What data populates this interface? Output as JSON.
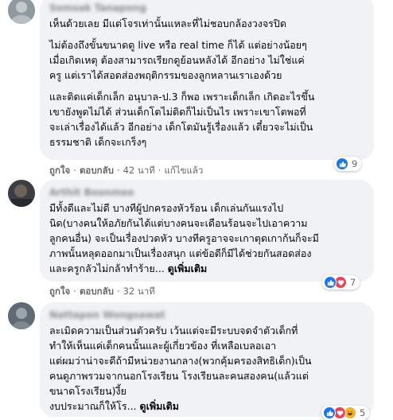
{
  "comments": [
    {
      "paragraphs": [
        "เห็นด้วยเลย มีแต่โจรเท่านั้นแหละที่ไม่ชอบกล้องวงจรปิด",
        "ไม่ต้องถึงขั้นขนาดดู live หรือ real time ก็ได้ แต่อย่างน้อยๆ\nเมื่อเกิดเหตุ ต้องสามารถเรียกดูย้อนหลังได้ อีกอย่าง ไม่ใช่แค่\nครู แต่เราได้สอดส่องพฤติกรรมของลูกหลานเราเองด้วย",
        "และติดแค่เด็กเล็ก อนุบาล-ป.3 ก็พอ เพราะเด็กเล็ก เกิดอะไรขึ้น\nเขายังพูดไม่ได้ ส่วนเด็กโตไม่ติดก็ไม่เป็นไร เพราะเขาโตพอที่\nจะเล่าเรื่องได้แล้ว อีกอย่าง เด็กโตมันรู้เรื่องแล้ว เดี๋ยวจะไม่เป็น\nธรรมชาติ เด็กจะเกร็งๆ"
      ],
      "see_more": "",
      "actions": {
        "like": "ถูกใจ",
        "reply": "ตอบกลับ",
        "time": "42 นาที",
        "edited": "แก้ไขแล้ว"
      },
      "reaction_count": "9",
      "reaction_types": [
        "like"
      ]
    },
    {
      "paragraphs": [
        "มีทั้งดีและไม่ดี บางทีผู้ปกครองหัวร้อน เด็กเล่นกันแรงไป\nนิด(บางคนให้อภัยกันได้แต่บางคนจะเดือนร้อนจะไปเอาความ\nลูกคนอื่น) จะเป็นเรื่องปวดหัว บางทีครูอาจจะเกาตุดเกาก้นก็จะมี\nภาพนั้นหลุดออกมาเป็นเรื่องสนุก แต่ข้อดีก็มีได้ช่วยกันสอดส่อง\nและครูกลัวไม่กล้าทำร้าย... "
      ],
      "see_more": "ดูเพิ่มเติม",
      "actions": {
        "like": "ถูกใจ",
        "reply": "ตอบกลับ",
        "time": "32 นาที",
        "edited": ""
      },
      "reaction_count": "7",
      "reaction_types": [
        "like",
        "love"
      ]
    },
    {
      "paragraphs": [
        "ละเมิดความเป็นส่วนตัวครับ เว้นแต่จะมีระบบจดจำตัวเด็กที่\nทำให้เห็นแค่เด็กคนนั้นและผู้เกี่ยวข้อง ที่เหลือเบลอเอา\nแต่ผมว่าน่าจะดีถ้ามีหน่วยงานกลาง(พวกคุ้มครองสิทธิเด็ก)เป็น\nคนดูภาพรวมจากนอกโรงเรียน โรงเรียนละคนสองคน(แล้วแต่\nขนาดโรงเรียน)งี้ย\nงบประมาณก็ให้โร... "
      ],
      "see_more": "ดูเพิ่มเติม",
      "actions": {
        "like": "",
        "reply": "",
        "time": "",
        "edited": ""
      },
      "reaction_count": "5",
      "reaction_types": [
        "like",
        "love",
        "haha"
      ]
    }
  ],
  "colors": {
    "bubble": "#f0f2f5",
    "meta_text": "#65676b",
    "like_blue": "#1877f2",
    "love_red": "#f33e58",
    "haha_yellow": "#f7b125"
  }
}
